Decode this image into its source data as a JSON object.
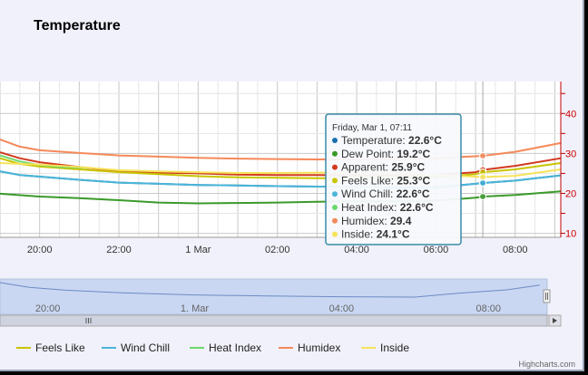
{
  "chart_data": {
    "type": "line",
    "title": "Temperature",
    "x_unit": "hours since midnight before 1 Mar (negative = 29 Feb)",
    "xlim": [
      -5.0,
      9.15
    ],
    "ylim": [
      9,
      48
    ],
    "x_tick_labels": [
      {
        "x": -4,
        "label": "20:00"
      },
      {
        "x": -2,
        "label": "22:00"
      },
      {
        "x": 0,
        "label": "1 Mar"
      },
      {
        "x": 2,
        "label": "02:00"
      },
      {
        "x": 4,
        "label": "04:00"
      },
      {
        "x": 6,
        "label": "06:00"
      },
      {
        "x": 8,
        "label": "08:00"
      }
    ],
    "y_tick_labels": [
      {
        "y": 10,
        "label": "10"
      },
      {
        "y": 20,
        "label": "20"
      },
      {
        "y": 30,
        "label": "30"
      },
      {
        "y": 40,
        "label": "40"
      }
    ],
    "series": [
      {
        "name": "Temperature",
        "color": "#1a6fb0",
        "x": [
          -5,
          -4.5,
          -4,
          -3,
          -2,
          -1,
          0,
          1,
          2,
          3,
          4,
          5,
          6,
          7,
          7.2,
          8,
          9.15
        ],
        "y": [
          25.5,
          24.6,
          24.2,
          23.4,
          22.7,
          22.4,
          22.1,
          22.0,
          21.8,
          21.7,
          21.6,
          21.5,
          21.5,
          22.4,
          22.6,
          23.2,
          24.5
        ]
      },
      {
        "name": "Dew Point",
        "color": "#3a9a2a",
        "x": [
          -5,
          -4,
          -3,
          -2,
          -1,
          0,
          1,
          2,
          3,
          4,
          5,
          6,
          7,
          7.2,
          8,
          9.15
        ],
        "y": [
          19.9,
          19.2,
          18.8,
          18.3,
          17.7,
          17.5,
          17.6,
          17.7,
          17.9,
          18.0,
          18.0,
          18.2,
          18.9,
          19.2,
          19.6,
          20.5
        ]
      },
      {
        "name": "Apparent",
        "color": "#d23a1f",
        "x": [
          -5,
          -4.5,
          -4,
          -3,
          -2,
          -1,
          0,
          1,
          2,
          3,
          4,
          5,
          6,
          7,
          7.2,
          8,
          9.15
        ],
        "y": [
          30.3,
          28.8,
          27.8,
          26.6,
          25.6,
          25.2,
          25.0,
          24.7,
          24.6,
          24.6,
          24.5,
          24.5,
          24.6,
          25.3,
          25.9,
          26.9,
          28.8
        ]
      },
      {
        "name": "Feels Like",
        "color": "#c8c400",
        "x": [
          -5,
          -4.5,
          -4,
          -3,
          -2,
          -1,
          0,
          1,
          2,
          3,
          4,
          5,
          6,
          7,
          7.2,
          8,
          9.15
        ],
        "y": [
          28.8,
          27.4,
          26.7,
          26.0,
          25.3,
          24.8,
          24.3,
          24.0,
          23.9,
          23.8,
          23.8,
          23.9,
          24.0,
          24.8,
          25.3,
          26.0,
          27.6
        ]
      },
      {
        "name": "Wind Chill",
        "color": "#4bb6d8",
        "x": [
          -5,
          -4.5,
          -4,
          -3,
          -2,
          -1,
          0,
          1,
          2,
          3,
          4,
          5,
          6,
          7,
          7.2,
          8,
          9.15
        ],
        "y": [
          25.5,
          24.6,
          24.2,
          23.4,
          22.7,
          22.4,
          22.1,
          22.0,
          21.8,
          21.7,
          21.6,
          21.5,
          21.5,
          22.4,
          22.6,
          23.2,
          24.5
        ]
      },
      {
        "name": "Heat Index",
        "color": "#6cd86c",
        "x": [
          -5,
          -4.5,
          -4,
          -3.5,
          -2.8
        ],
        "y": [
          29.5,
          28.0,
          27.1,
          26.6,
          26.4
        ]
      },
      {
        "name": "Humidex",
        "color": "#f5895a",
        "x": [
          -5,
          -4.5,
          -4,
          -3,
          -2,
          -1,
          0,
          1,
          2,
          3,
          4,
          5,
          6,
          7,
          7.2,
          8,
          9.15
        ],
        "y": [
          33.5,
          31.7,
          30.8,
          30.1,
          29.5,
          29.2,
          28.9,
          28.7,
          28.6,
          28.5,
          28.5,
          28.6,
          28.8,
          29.3,
          29.4,
          30.4,
          32.6
        ]
      },
      {
        "name": "Inside",
        "color": "#f6e35a",
        "x": [
          -5,
          -4,
          -3,
          -2,
          -1,
          0,
          1,
          2,
          3,
          4,
          5,
          6,
          7,
          7.2,
          8,
          9.15
        ],
        "y": [
          27.6,
          27.2,
          26.6,
          25.8,
          25.5,
          25.3,
          25.1,
          25.1,
          25.2,
          25.2,
          25.1,
          24.6,
          24.2,
          24.1,
          24.4,
          26.0
        ]
      }
    ],
    "legend": {
      "placement": "bottom",
      "visible_items": [
        "Feels Like",
        "Wind Chill",
        "Heat Index",
        "Humidex",
        "Inside"
      ]
    },
    "crosshair_x": 7.183,
    "tooltip": {
      "header": "Friday, Mar 1, 07:11",
      "rows": [
        {
          "name": "Temperature",
          "value": "22.6°C",
          "color": "#1a6fb0"
        },
        {
          "name": "Dew Point",
          "value": "19.2°C",
          "color": "#3a9a2a"
        },
        {
          "name": "Apparent",
          "value": "25.9°C",
          "color": "#d23a1f"
        },
        {
          "name": "Feels Like",
          "value": "25.3°C",
          "color": "#c8c400"
        },
        {
          "name": "Wind Chill",
          "value": "22.6°C",
          "color": "#4bb6d8"
        },
        {
          "name": "Heat Index",
          "value": "22.6°C",
          "color": "#6cd86c"
        },
        {
          "name": "Humidex",
          "value": "29.4",
          "color": "#f5895a"
        },
        {
          "name": "Inside",
          "value": "24.1°C",
          "color": "#f6e35a"
        }
      ]
    },
    "navigator": {
      "x_tick_labels": [
        {
          "x": -4,
          "label": "20:00"
        },
        {
          "x": 0,
          "label": "1. Mar"
        },
        {
          "x": 4,
          "label": "04:00"
        },
        {
          "x": 8,
          "label": "08:00"
        }
      ],
      "series": {
        "x": [
          -5.3,
          -4.5,
          -3.5,
          -2,
          0,
          2,
          4,
          6,
          7.2,
          8.5,
          9.4
        ],
        "y": [
          25.5,
          24.2,
          23.4,
          22.7,
          22.1,
          21.8,
          21.6,
          21.5,
          22.6,
          23.5,
          24.8
        ]
      }
    },
    "credit": "Highcharts.com"
  }
}
